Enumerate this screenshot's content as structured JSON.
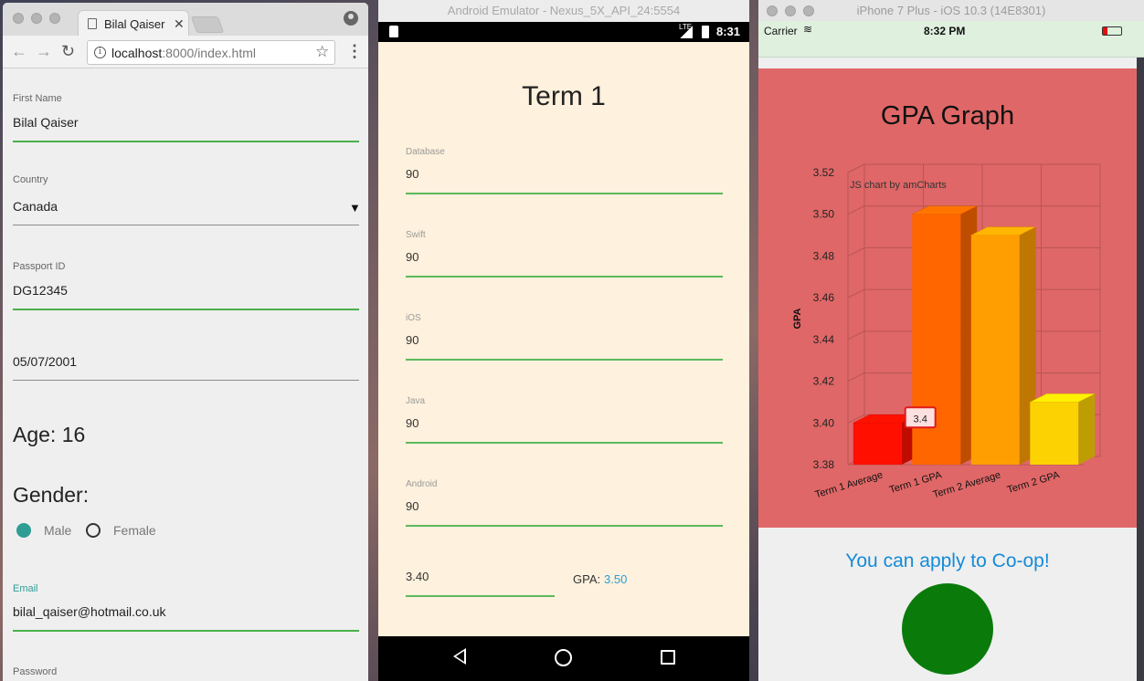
{
  "chrome": {
    "tab_title": "Bilal Qaiser",
    "url_host": "localhost",
    "url_rest": ":8000/index.html",
    "info_icon": "i",
    "form": {
      "first_name_label": "First Name",
      "first_name_value": "Bilal Qaiser",
      "country_label": "Country",
      "country_value": "Canada",
      "passport_label": "Passport ID",
      "passport_value": "DG12345",
      "date_value": "05/07/2001",
      "age_text": "Age: 16",
      "gender_heading": "Gender:",
      "gender_options": [
        "Male",
        "Female"
      ],
      "gender_selected": "Male",
      "email_label": "Email",
      "email_value": "bilal_qaiser@hotmail.co.uk",
      "password_label": "Password"
    }
  },
  "android": {
    "window_title": "Android Emulator - Nexus_5X_API_24:5554",
    "status_time": "8:31",
    "network_label": "LTE",
    "heading": "Term 1",
    "fields": [
      {
        "label": "Database",
        "value": "90"
      },
      {
        "label": "Swift",
        "value": "90"
      },
      {
        "label": "iOS",
        "value": "90"
      },
      {
        "label": "Java",
        "value": "90"
      },
      {
        "label": "Android",
        "value": "90"
      }
    ],
    "average_value": "3.40",
    "gpa_label": "GPA:",
    "gpa_value": "3.50",
    "gpa_color": "#2a9fd6"
  },
  "ios": {
    "window_title": "iPhone 7 Plus - iOS 10.3 (14E8301)",
    "carrier": "Carrier",
    "status_time": "8:32 PM",
    "chart_title": "GPA Graph",
    "message": "You can apply to Co-op!",
    "circle_color": "#0a7b0a",
    "card_color": "#e06767"
  },
  "chart_data": {
    "type": "bar",
    "title": "GPA Graph",
    "watermark": "JS chart by amCharts",
    "categories": [
      "Term 1 Average",
      "Term 1 GPA",
      "Term 2 Average",
      "Term 2 GPA"
    ],
    "values": [
      3.4,
      3.5,
      3.49,
      3.41
    ],
    "colors": [
      "#ff0f00",
      "#ff6600",
      "#ff9e01",
      "#fcd202"
    ],
    "ylabel": "GPA",
    "xlabel": "",
    "ylim": [
      3.38,
      3.52
    ],
    "yticks": [
      "3.52",
      "3.50",
      "3.48",
      "3.46",
      "3.44",
      "3.42",
      "3.40",
      "3.38"
    ],
    "balloon_text": "3.4",
    "grid": true,
    "depth_3d": true
  }
}
